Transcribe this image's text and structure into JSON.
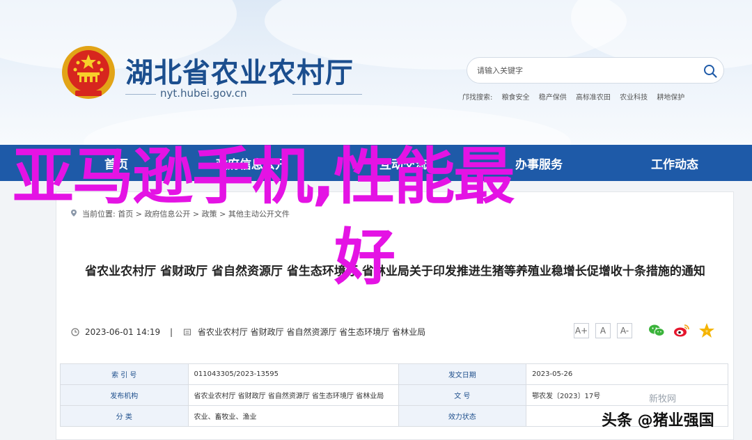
{
  "site": {
    "title": "湖北省农业农村厅",
    "url": "nyt.hubei.gov.cn"
  },
  "search": {
    "placeholder": "请输入关键字",
    "hot_label": "邝找搜索:",
    "hot_terms": [
      "粮食安全",
      "稳产保供",
      "高标准农田",
      "农业科技",
      "耕地保护"
    ]
  },
  "nav": {
    "items": [
      "首页",
      "政府信息公开",
      "互动交流",
      "办事服务",
      "工作动态"
    ]
  },
  "breadcrumb": {
    "prefix": "当前位置:",
    "path": [
      "首页",
      "政府信息公开",
      "政策",
      "其他主动公开文件"
    ]
  },
  "document": {
    "title": "省农业农村厅 省财政厅 省自然资源厅 省生态环境厅 省林业局关于印发推进生猪等养殖业稳增长促增收十条措施的通知",
    "date": "2023-06-01 14:19",
    "sep": "|",
    "sources": "省农业农村厅 省财政厅 省自然资源厅 省生态环境厅 省林业局",
    "font_sizes": [
      "A+",
      "A",
      "A-"
    ]
  },
  "meta": {
    "rows": [
      [
        {
          "k": "索 引 号",
          "v": "011043305/2023-13595"
        },
        {
          "k": "发文日期",
          "v": "2023-05-26"
        }
      ],
      [
        {
          "k": "发布机构",
          "v": "省农业农村厅 省财政厅 省自然资源厅 省生态环境厅 省林业局"
        },
        {
          "k": "文 号",
          "v": "鄂农发〔2023〕17号"
        }
      ],
      [
        {
          "k": "分 类",
          "v": "农业、畜牧业、渔业"
        },
        {
          "k": "效力状态",
          "v": ""
        }
      ]
    ]
  },
  "overlay": {
    "line1": "亚马逊手机,性能最",
    "line2": "好",
    "color": "#e413e4"
  },
  "watermark": {
    "stamp": "新牧网",
    "text": "头条 @猪业强国"
  },
  "colors": {
    "nav": "#1e5aa8",
    "title": "#1b4e8e"
  }
}
